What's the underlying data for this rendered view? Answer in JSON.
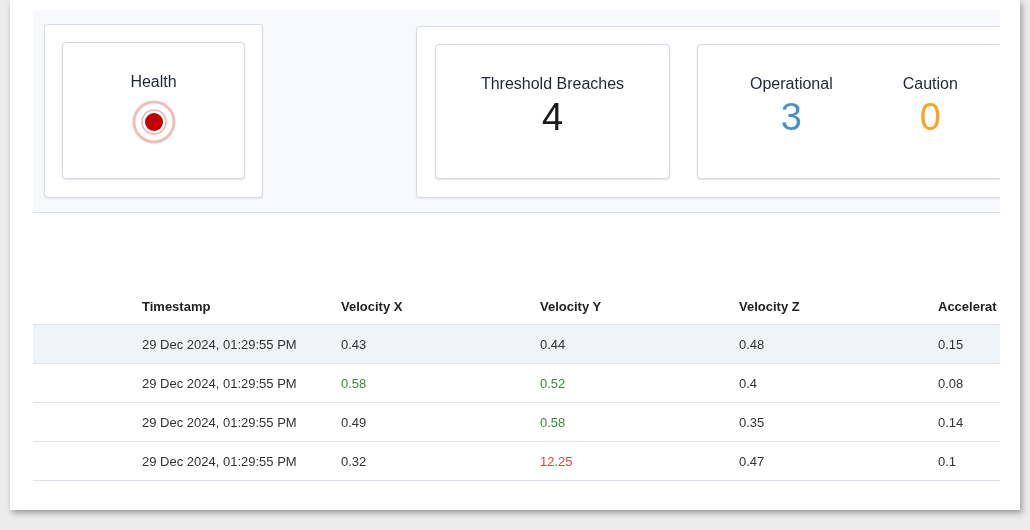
{
  "health": {
    "title": "Health",
    "color": "#c00000"
  },
  "stats": [
    {
      "label": "Threshold Breaches",
      "value": "4",
      "color": "#1a1a1a"
    }
  ],
  "status_counts": [
    {
      "label": "Operational",
      "value": "3",
      "color": "#4a90c8"
    },
    {
      "label": "Caution",
      "value": "0",
      "color": "#f5a623"
    }
  ],
  "table": {
    "columns": [
      "Timestamp",
      "Velocity X",
      "Velocity Y",
      "Velocity Z",
      "Accelerat"
    ],
    "rows": [
      {
        "highlighted": true,
        "cells": [
          {
            "text": "29 Dec 2024, 01:29:55 PM",
            "color": "#333333"
          },
          {
            "text": "0.43",
            "color": "#333333"
          },
          {
            "text": "0.44",
            "color": "#333333"
          },
          {
            "text": "0.48",
            "color": "#333333"
          },
          {
            "text": "0.15",
            "color": "#333333"
          }
        ]
      },
      {
        "highlighted": false,
        "cells": [
          {
            "text": "29 Dec 2024, 01:29:55 PM",
            "color": "#333333"
          },
          {
            "text": "0.58",
            "color": "#3a8a3a"
          },
          {
            "text": "0.52",
            "color": "#3a8a3a"
          },
          {
            "text": "0.4",
            "color": "#333333"
          },
          {
            "text": "0.08",
            "color": "#333333"
          }
        ]
      },
      {
        "highlighted": false,
        "cells": [
          {
            "text": "29 Dec 2024, 01:29:55 PM",
            "color": "#333333"
          },
          {
            "text": "0.49",
            "color": "#333333"
          },
          {
            "text": "0.58",
            "color": "#3a8a3a"
          },
          {
            "text": "0.35",
            "color": "#333333"
          },
          {
            "text": "0.14",
            "color": "#333333"
          }
        ]
      },
      {
        "highlighted": false,
        "cells": [
          {
            "text": "29 Dec 2024, 01:29:55 PM",
            "color": "#333333"
          },
          {
            "text": "0.32",
            "color": "#333333"
          },
          {
            "text": "12.25",
            "color": "#ee3b3b"
          },
          {
            "text": "0.47",
            "color": "#333333"
          },
          {
            "text": "0.1",
            "color": "#333333"
          }
        ]
      }
    ]
  }
}
